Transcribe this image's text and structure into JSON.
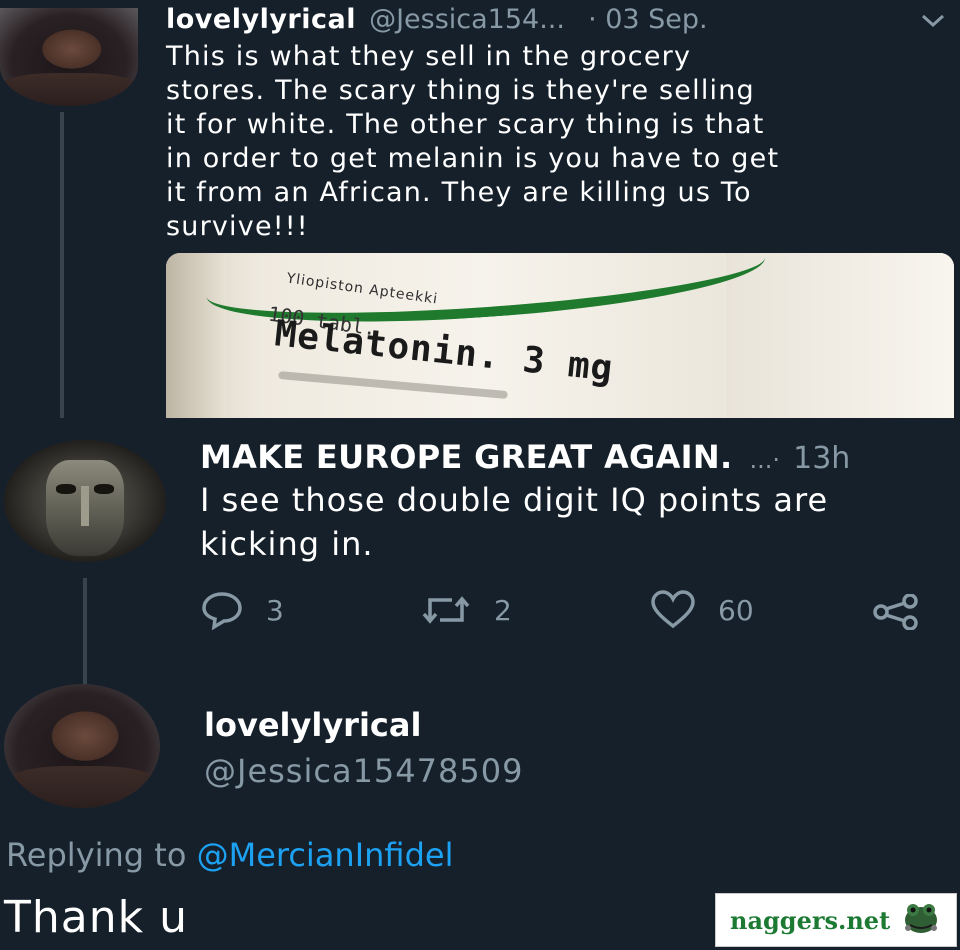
{
  "tweet1": {
    "display_name": "lovelylyrical",
    "handle": "@Jessica154...",
    "timestamp": "· 03 Sep.",
    "text_lines": [
      "This is what they sell in the grocery",
      "stores. The scary thing is they're selling",
      "it for white. The other scary thing is that",
      "in order to get melanin is you have to get",
      "it from an African. They are killing us To",
      "survive!!!"
    ],
    "media": {
      "label_top": "Yliopiston Apteekki",
      "label_qty": "100 tabl.",
      "label_main": "Melatonin. 3 mg"
    }
  },
  "tweet2": {
    "display_name": "MAKE EUROPE GREAT AGAIN.",
    "more": "...·",
    "timestamp": "13h",
    "text_lines": [
      "I see those double digit IQ points are",
      "kicking in."
    ],
    "actions": {
      "reply_count": "3",
      "retweet_count": "2",
      "like_count": "60"
    }
  },
  "tweet3": {
    "display_name": "lovelylyrical",
    "handle": "@Jessica15478509",
    "replying_prefix": "Replying to",
    "replying_to": "@MercianInfidel",
    "text": "Thank u"
  },
  "watermark": {
    "text": "naggers.net"
  },
  "colors": {
    "background": "#15202b",
    "muted": "#8899a6",
    "link": "#1da1f2",
    "watermark_green": "#1d7a33"
  }
}
